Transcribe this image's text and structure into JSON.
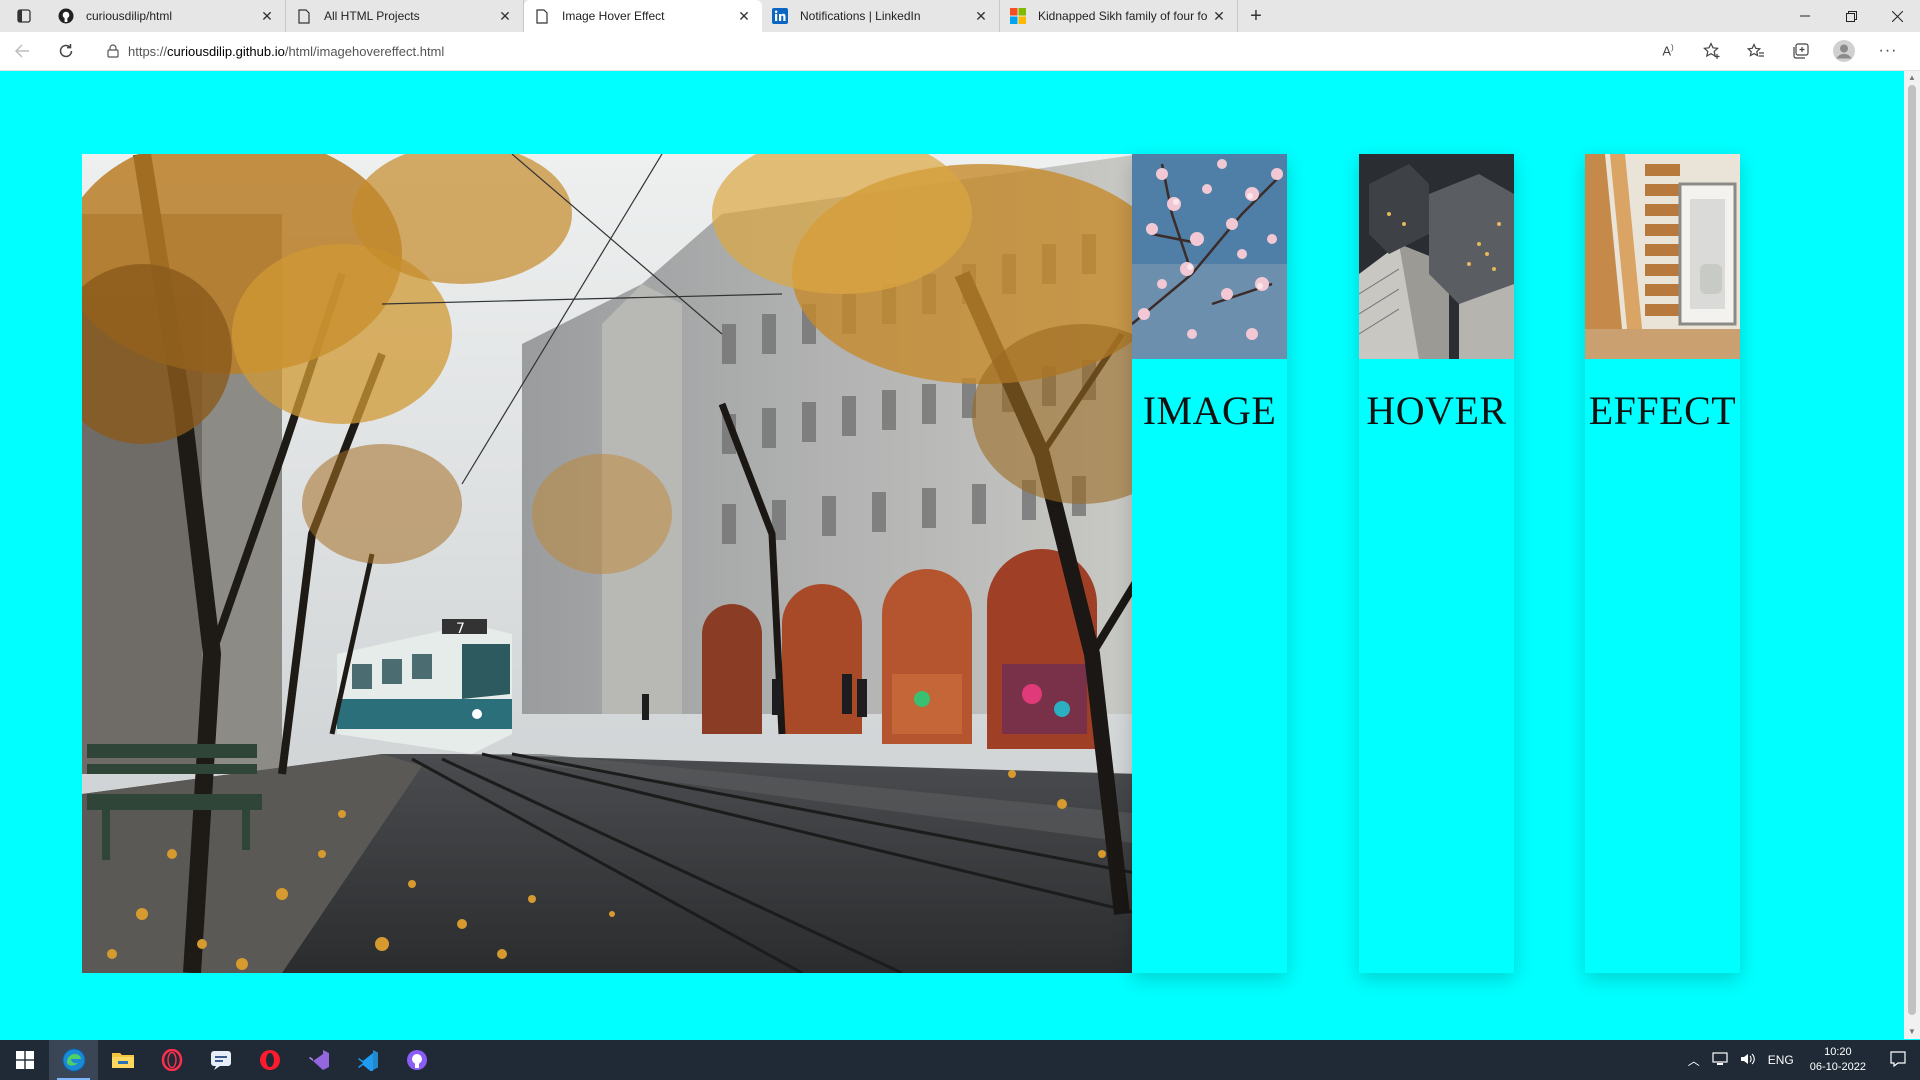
{
  "browser": {
    "tabs": [
      {
        "title": "curiousdilip/html",
        "icon": "github-icon",
        "active": false
      },
      {
        "title": "All HTML Projects",
        "icon": "page-icon",
        "active": false
      },
      {
        "title": "Image Hover Effect",
        "icon": "page-icon",
        "active": true
      },
      {
        "title": "Notifications | LinkedIn",
        "icon": "linkedin-icon",
        "active": false
      },
      {
        "title": "Kidnapped Sikh family of four fo",
        "icon": "microsoft-icon",
        "active": false
      }
    ],
    "new_tab_label": "+",
    "url_prefix": "https://",
    "url_domain": "curiousdilip.github.io",
    "url_path": "/html/imagehovereffect.html"
  },
  "page": {
    "background": "#00ffff",
    "cards": [
      {
        "label": "IMAGE",
        "image": "cherry-blossom"
      },
      {
        "label": "HOVER",
        "image": "city-aerial"
      },
      {
        "label": "EFFECT",
        "image": "wooden-stairs"
      }
    ]
  },
  "taskbar": {
    "apps": [
      "windows-start",
      "edge",
      "file-explorer",
      "opera-gx",
      "chat",
      "opera",
      "visual-studio",
      "vs-code",
      "github-desktop"
    ],
    "language": "ENG",
    "time": "10:20",
    "date": "06-10-2022"
  }
}
